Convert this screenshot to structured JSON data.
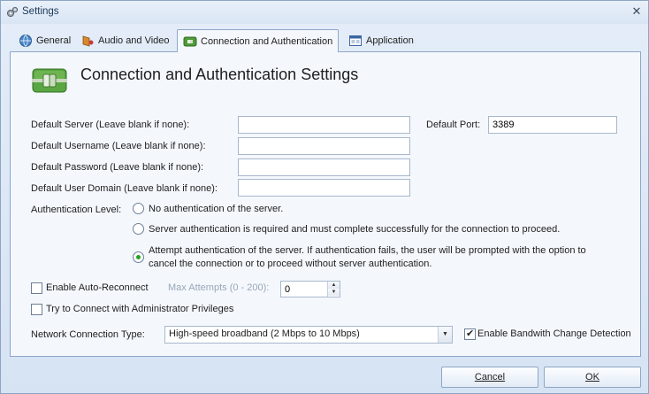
{
  "window": {
    "title": "Settings",
    "close_glyph": "✕"
  },
  "tabs": [
    {
      "label": "General",
      "icon": "globe-icon"
    },
    {
      "label": "Audio and Video",
      "icon": "media-icon"
    },
    {
      "label": "Connection and Authentication",
      "icon": "connection-icon",
      "active": true
    },
    {
      "label": "Application",
      "icon": "window-icon"
    }
  ],
  "header": {
    "title": "Connection and Authentication Settings",
    "icon": "connection-plug-icon"
  },
  "fields": {
    "server": {
      "label": "Default Server (Leave blank if none):",
      "value": ""
    },
    "port": {
      "label": "Default Port:",
      "value": "3389"
    },
    "username": {
      "label": "Default Username (Leave blank if none):",
      "value": ""
    },
    "password": {
      "label": "Default Password (Leave blank if none):",
      "value": ""
    },
    "domain": {
      "label": "Default User Domain (Leave blank if none):",
      "value": ""
    }
  },
  "auth": {
    "label": "Authentication Level:",
    "options": [
      {
        "text": "No authentication of the server.",
        "checked": false
      },
      {
        "text": "Server authentication is required and must complete successfully for the connection to proceed.",
        "checked": false
      },
      {
        "text_line1": "Attempt authentication of the server. If authentication fails, the user will be prompted with the option to",
        "text_line2": "cancel the connection or to proceed without server authentication.",
        "checked": true
      }
    ]
  },
  "reconnect": {
    "label": "Enable Auto-Reconnect",
    "checked": false,
    "max_label": "Max Attempts (0 - 200):",
    "max_value": "0"
  },
  "admin": {
    "label": "Try to Connect with Administrator Privileges",
    "checked": false
  },
  "network": {
    "label": "Network Connection Type:",
    "selected": "High-speed broadband (2 Mbps to 10 Mbps)",
    "bandwidth_label": "Enable Bandwith Change Detection",
    "bandwidth_checked": true
  },
  "buttons": {
    "cancel": "Cancel",
    "ok": "OK"
  },
  "colors": {
    "accent_green": "#22a51e",
    "border": "#8ea6c8",
    "background": "#dbe6f4"
  }
}
